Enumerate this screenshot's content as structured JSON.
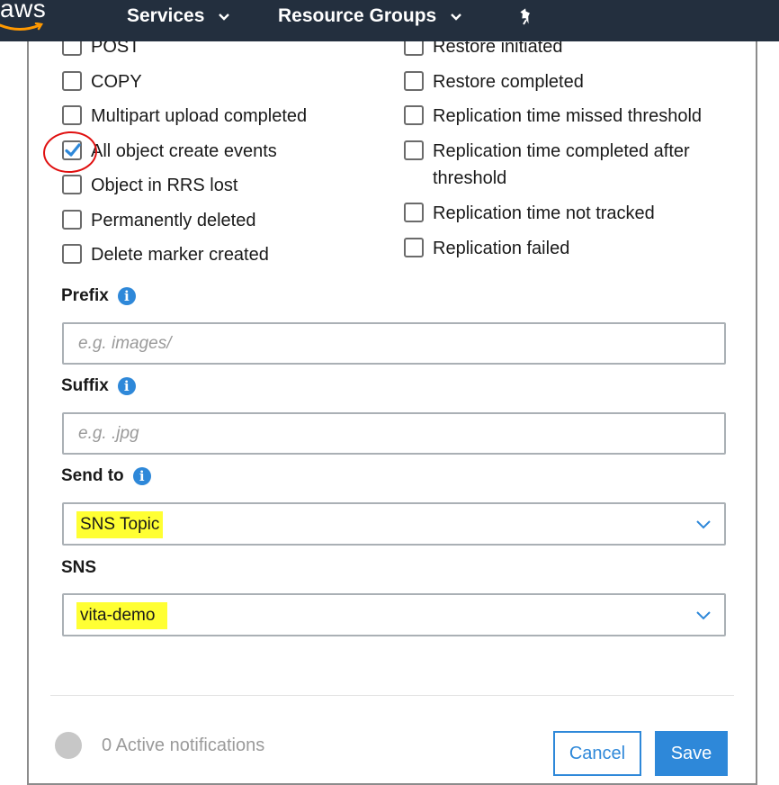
{
  "nav": {
    "logo": "aws",
    "services_label": "Services",
    "resource_groups_label": "Resource Groups"
  },
  "events": {
    "left": [
      {
        "label": "POST",
        "checked": false
      },
      {
        "label": "COPY",
        "checked": false
      },
      {
        "label": "Multipart upload completed",
        "checked": false
      },
      {
        "label": "All object create events",
        "checked": true
      },
      {
        "label": "Object in RRS lost",
        "checked": false
      },
      {
        "label": "Permanently deleted",
        "checked": false
      },
      {
        "label": "Delete marker created",
        "checked": false
      }
    ],
    "right": [
      {
        "label": "Restore initiated",
        "checked": false
      },
      {
        "label": "Restore completed",
        "checked": false
      },
      {
        "label": "Replication time missed threshold",
        "checked": false
      },
      {
        "label": "Replication time completed after threshold",
        "checked": false
      },
      {
        "label": "Replication time not tracked",
        "checked": false
      },
      {
        "label": "Replication failed",
        "checked": false
      }
    ]
  },
  "prefix": {
    "label": "Prefix",
    "placeholder": "e.g. images/",
    "value": ""
  },
  "suffix": {
    "label": "Suffix",
    "placeholder": "e.g. .jpg",
    "value": ""
  },
  "send_to": {
    "label": "Send to",
    "value": "SNS Topic"
  },
  "sns": {
    "label": "SNS",
    "value": "vita-demo"
  },
  "footer": {
    "active_notifications": "0 Active notifications",
    "cancel_label": "Cancel",
    "save_label": "Save"
  },
  "colors": {
    "accent": "#2e88d9",
    "nav_bg": "#232f3e",
    "highlight": "#ffff33",
    "annotation": "#e01010"
  }
}
